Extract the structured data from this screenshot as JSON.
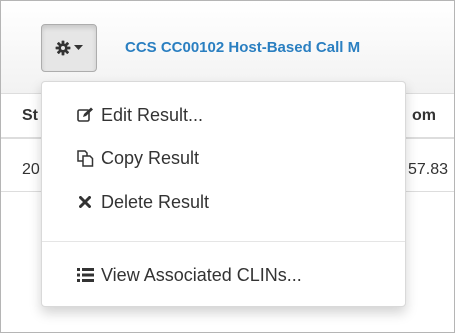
{
  "toolbar": {
    "gear_icon": "gear-icon",
    "caret_icon": "caret-down-icon",
    "title_link": "CCS CC00102 Host-Based Call M"
  },
  "table": {
    "header_fragments": [
      "St",
      "om"
    ],
    "row_fragments": [
      "20",
      "57.83"
    ]
  },
  "menu": {
    "items": [
      {
        "label": "Edit Result...",
        "icon": "edit-icon"
      },
      {
        "label": "Copy Result",
        "icon": "copy-icon"
      },
      {
        "label": "Delete Result",
        "icon": "close-icon"
      },
      {
        "label": "View Associated CLINs...",
        "icon": "list-icon"
      }
    ]
  },
  "colors": {
    "link": "#2a7fc1",
    "text": "#333333",
    "button_active_bg": "#e6e6e6"
  }
}
